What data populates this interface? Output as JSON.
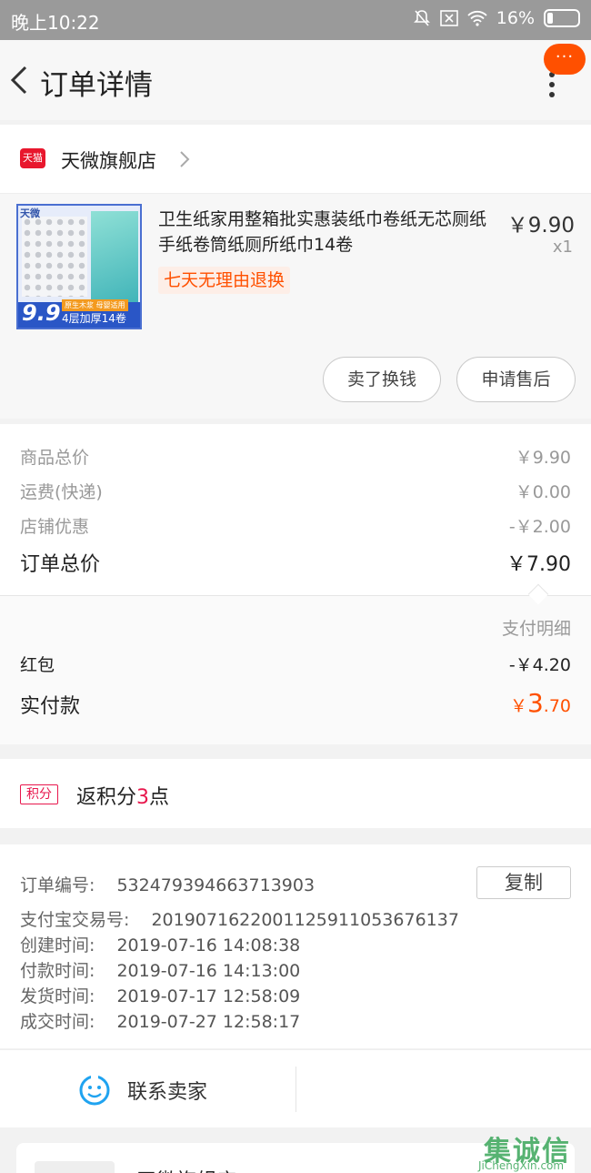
{
  "status_bar": {
    "time": "晚上10:22",
    "battery": "16%"
  },
  "header": {
    "title": "订单详情",
    "bubble": "···"
  },
  "store": {
    "platform_badge": "天猫",
    "name": "天微旗舰店"
  },
  "product": {
    "title": "卫生纸家用整箱批实惠装纸巾卷纸无芯厕纸手纸卷筒纸厕所纸巾14卷",
    "price": "￥9.90",
    "quantity": "x1",
    "return_policy": "七天无理由退换",
    "image_texts": {
      "brand": "天微",
      "price": "9.9",
      "tag_top": "原生木浆 母婴适用",
      "tag_bottom": "4层加厚14卷"
    },
    "buttons": {
      "sell": "卖了换钱",
      "after_sale": "申请售后"
    }
  },
  "summary": {
    "rows": [
      {
        "label": "商品总价",
        "value": "￥9.90"
      },
      {
        "label": "运费(快递)",
        "value": "￥0.00"
      },
      {
        "label": "店铺优惠",
        "value": "-￥2.00"
      }
    ],
    "total_label": "订单总价",
    "total_value": "￥7.90",
    "payment_detail_label": "支付明细",
    "red_packet_label": "红包",
    "red_packet_value": "-￥4.20",
    "paid_label": "实付款",
    "paid_currency": "￥",
    "paid_integer": "3",
    "paid_decimal": ".70"
  },
  "points": {
    "badge": "积分",
    "prefix": "返积分",
    "number": "3",
    "suffix": "点"
  },
  "order_info": {
    "order_no_label": "订单编号:",
    "order_no": "532479394663713903",
    "copy_label": "复制",
    "alipay_label": "支付宝交易号:",
    "alipay_no": "2019071622001125911053676137",
    "created_label": "创建时间:",
    "created": "2019-07-16 14:08:38",
    "paid_label": "付款时间:",
    "paid": "2019-07-16 14:13:00",
    "shipped_label": "发货时间:",
    "shipped": "2019-07-17 12:58:09",
    "completed_label": "成交时间:",
    "completed": "2019-07-27 12:58:17"
  },
  "contact": {
    "label": "联系卖家"
  },
  "bottom_card": {
    "name": "天微旗舰店"
  },
  "watermark": {
    "cn": "集诚信",
    "en": "JiChengXin.com"
  },
  "colors": {
    "accent": "#ff5000",
    "tmall_red": "#e8172d",
    "points_red": "#e8174d"
  },
  "icons": [
    "back-arrow-icon",
    "more-icon",
    "chevron-right-icon",
    "smile-chat-icon",
    "mute-icon",
    "wifi-icon",
    "battery-icon"
  ]
}
